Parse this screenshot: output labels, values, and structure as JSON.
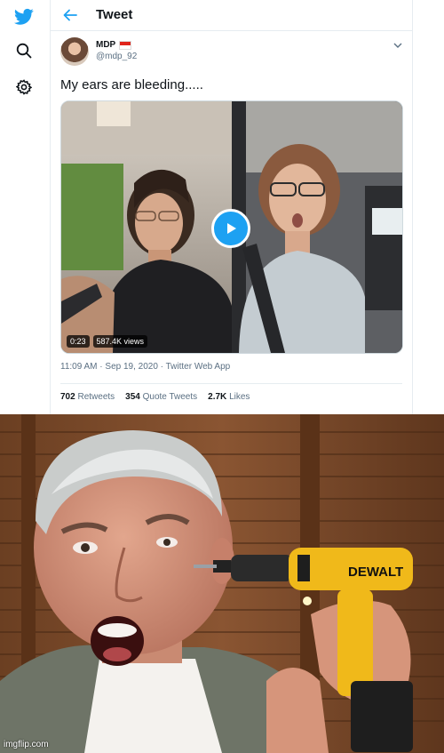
{
  "header": {
    "title": "Tweet"
  },
  "tweet": {
    "name": "MDP",
    "handle": "@mdp_92",
    "text": "My ears are bleeding.....",
    "video": {
      "duration": "0:23",
      "views": "587.4K views"
    },
    "meta": "11:09 AM · Sep 19, 2020 · Twitter Web App",
    "stats": [
      {
        "count": "702",
        "label": "Retweets"
      },
      {
        "count": "354",
        "label": "Quote Tweets"
      },
      {
        "count": "2.7K",
        "label": "Likes"
      }
    ]
  },
  "photo": {
    "drill_brand": "DEWALT"
  },
  "watermark": "imgflip.com",
  "colors": {
    "accent": "#1da1f2",
    "text": "#0f1419",
    "muted": "#5b7083",
    "border": "#e6ecf0"
  }
}
